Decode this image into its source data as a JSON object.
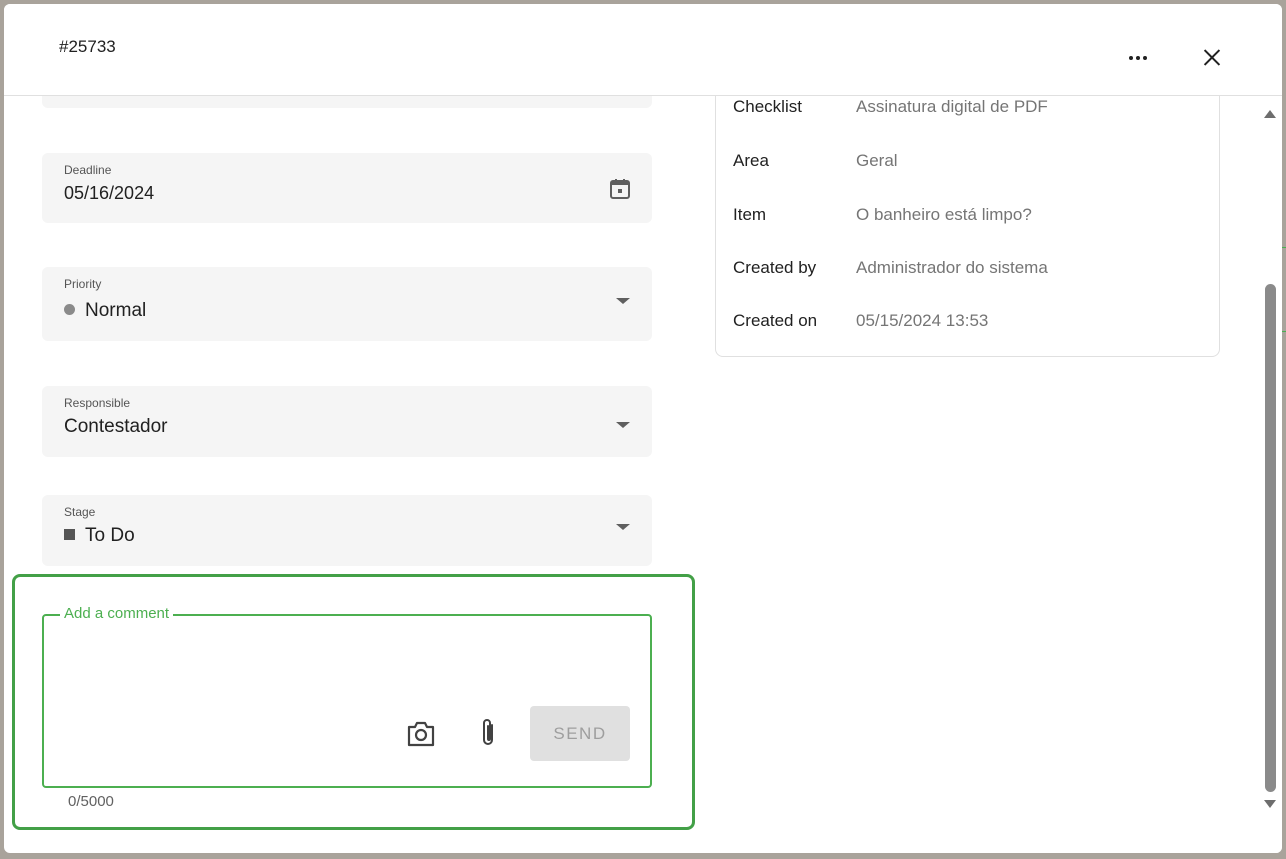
{
  "header": {
    "ticket_id": "#25733"
  },
  "form": {
    "deadline": {
      "label": "Deadline",
      "value": "05/16/2024"
    },
    "priority": {
      "label": "Priority",
      "value": "Normal",
      "color": "#8a8a8a"
    },
    "responsible": {
      "label": "Responsible",
      "value": "Contestador"
    },
    "stage": {
      "label": "Stage",
      "value": "To Do",
      "color": "#555555"
    }
  },
  "comment": {
    "label": "Add a comment",
    "value": "",
    "send_label": "SEND",
    "counter": "0/5000"
  },
  "details": [
    {
      "key": "Checklist",
      "value": "Assinatura digital de PDF"
    },
    {
      "key": "Area",
      "value": "Geral"
    },
    {
      "key": "Item",
      "value": "O banheiro está limpo?"
    },
    {
      "key": "Created by",
      "value": "Administrador do sistema"
    },
    {
      "key": "Created on",
      "value": "05/15/2024 13:53"
    }
  ],
  "colors": {
    "accent": "#4caf50",
    "highlight": "#43a047"
  },
  "icons": [
    "more-icon",
    "close-icon",
    "calendar-icon",
    "camera-icon",
    "paperclip-icon"
  ]
}
